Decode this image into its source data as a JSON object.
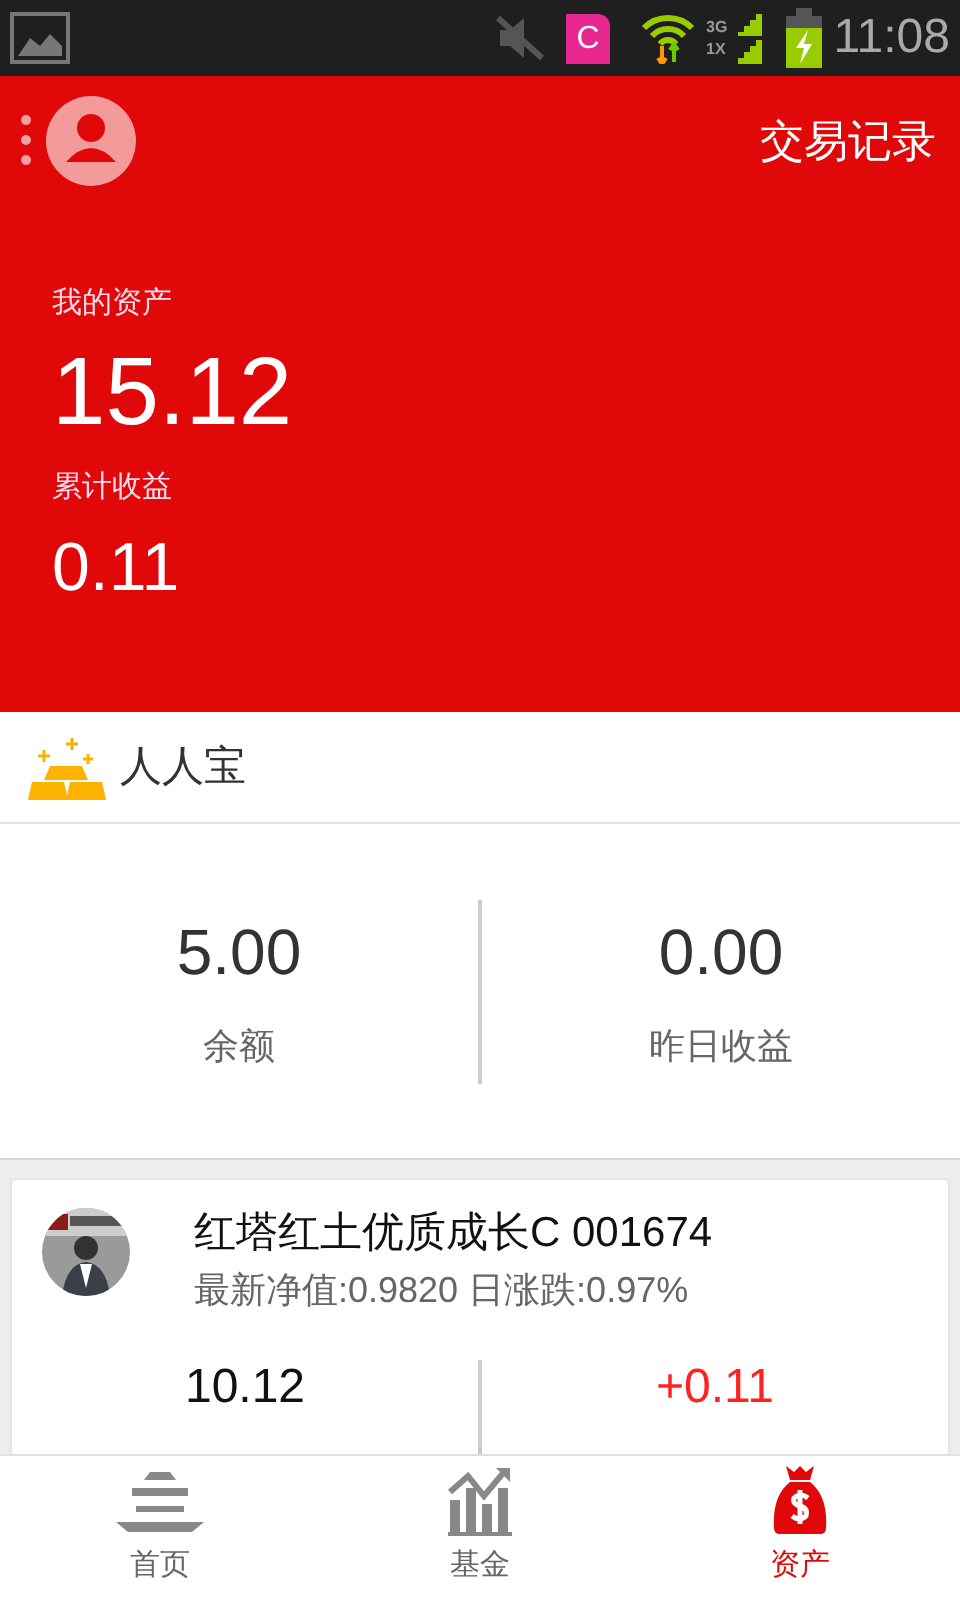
{
  "status_bar": {
    "notification_letter": "C",
    "network_labels": [
      "3G",
      "1X"
    ],
    "time": "11:08"
  },
  "header": {
    "title": "交易记录",
    "asset_label": "我的资产",
    "asset_value": "15.12",
    "income_label": "累计收益",
    "income_value": "0.11"
  },
  "renrenbao": {
    "title": "人人宝",
    "stats": [
      {
        "value": "5.00",
        "label": "余额"
      },
      {
        "value": "0.00",
        "label": "昨日收益"
      }
    ]
  },
  "fund": {
    "name": "红塔红土优质成长C 001674",
    "detail": "最新净值:0.9820 日涨跌:0.97%",
    "stats": [
      {
        "value": "10.12",
        "kind": "plain"
      },
      {
        "value": "+0.11",
        "kind": "gain"
      }
    ]
  },
  "bottom_nav": [
    {
      "label": "首页",
      "kind": "home",
      "selected": false
    },
    {
      "label": "基金",
      "kind": "fund",
      "selected": false
    },
    {
      "label": "资产",
      "kind": "assets",
      "selected": true
    }
  ]
}
